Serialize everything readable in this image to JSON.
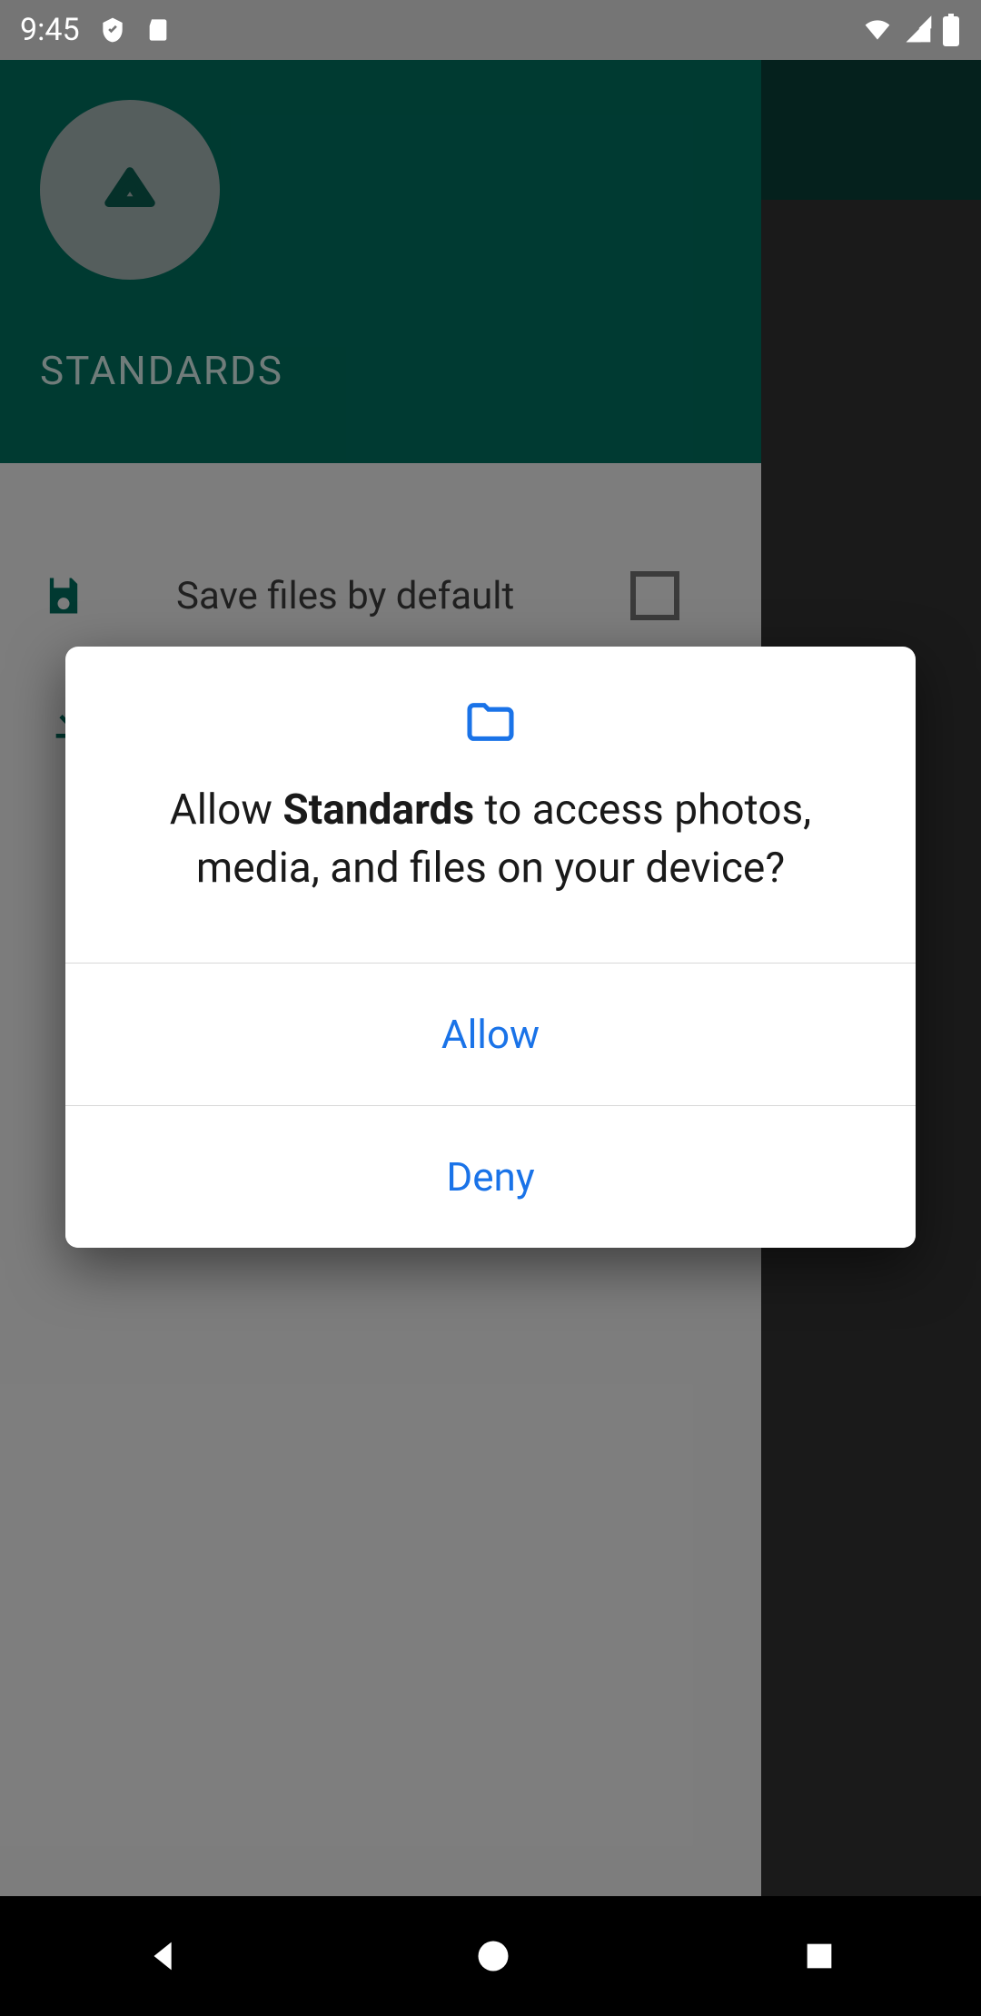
{
  "status": {
    "time": "9:45"
  },
  "app": {
    "title": "STANDARDS",
    "settings": {
      "save_files_label": "Save files by default",
      "save_files_checked": false
    }
  },
  "dialog": {
    "app_name": "Standards",
    "prompt_prefix": "Allow ",
    "prompt_suffix": " to access photos, media, and files on your device?",
    "allow_label": "Allow",
    "deny_label": "Deny"
  },
  "colors": {
    "accent_blue": "#1a73e8",
    "header_teal": "#006b5c"
  }
}
